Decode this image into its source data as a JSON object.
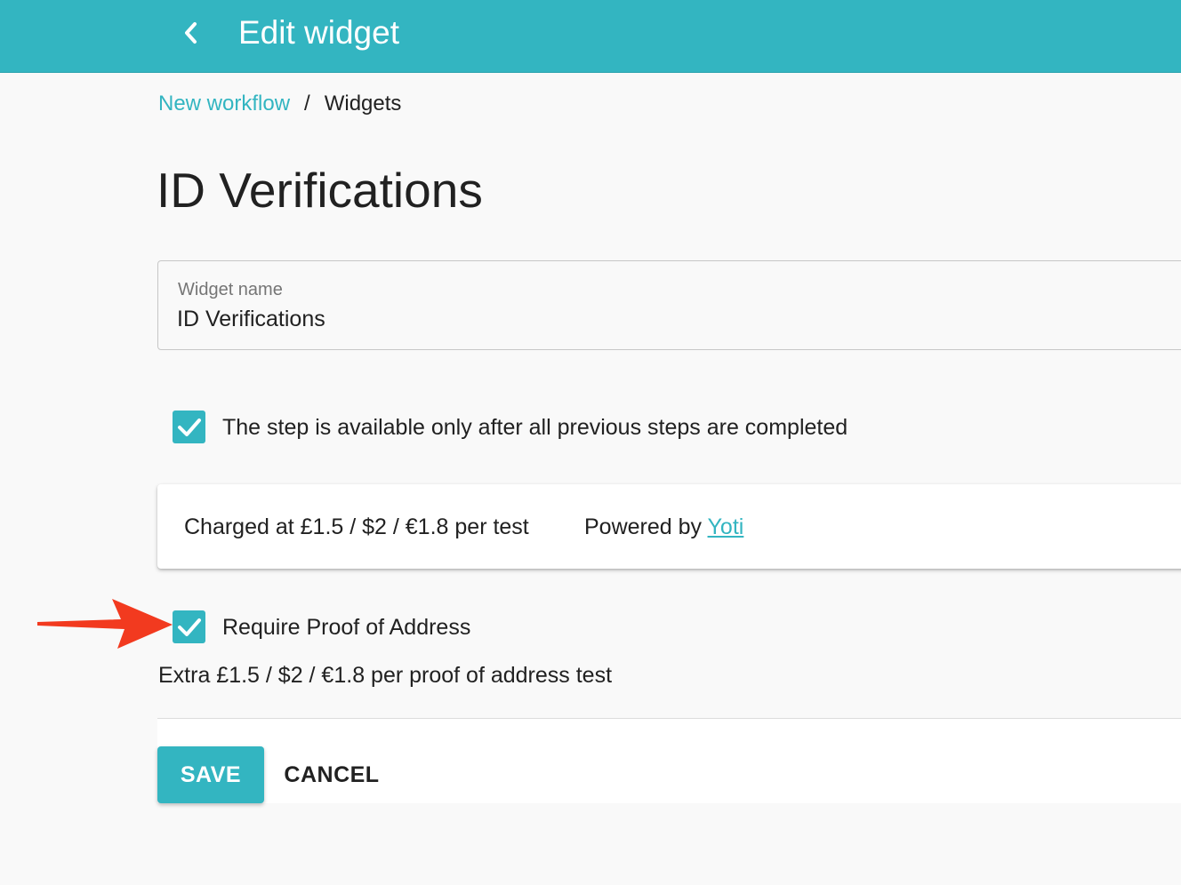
{
  "header": {
    "title": "Edit widget",
    "back_icon": "chevron-left-icon",
    "color": "#33b5c1"
  },
  "breadcrumb": {
    "link": "New workflow",
    "separator": "/",
    "current": "Widgets"
  },
  "page": {
    "title": "ID Verifications"
  },
  "widget_name_field": {
    "label": "Widget name",
    "value": "ID Verifications"
  },
  "sequential_option": {
    "checked": true,
    "label": "The step is available only after all previous steps are completed"
  },
  "pricing_card": {
    "charge": "Charged at £1.5 / $2 / €1.8 per test",
    "powered_prefix": "Powered by",
    "powered_link": "Yoti"
  },
  "proof_of_address_option": {
    "checked": true,
    "label": "Require Proof of Address",
    "extra": "Extra £1.5 / $2 / €1.8 per proof of address test"
  },
  "actions": {
    "save_label": "SAVE",
    "cancel_label": "CANCEL"
  },
  "annotation": {
    "arrow_icon": "red-arrow-icon",
    "color": "#f23a1f"
  }
}
